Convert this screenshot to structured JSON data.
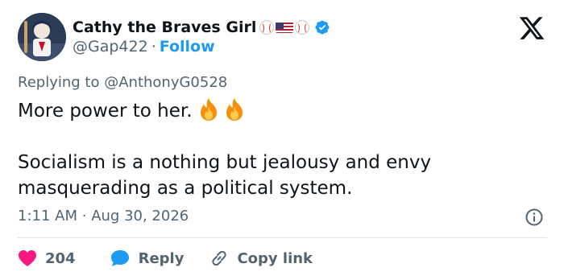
{
  "user": {
    "display_name": "Cathy the Braves Girl",
    "handle": "@Gap422",
    "separator": "·",
    "follow_label": "Follow",
    "badges": [
      "baseball-icon",
      "us-flag-icon",
      "baseball-icon",
      "verified-badge-icon"
    ]
  },
  "tweet": {
    "replying_to_prefix": "Replying to",
    "replying_to_handle": "@AnthonyG0528",
    "line1": "More power to her.",
    "line2": "Socialism is a nothing but jealousy and envy",
    "line3": "masquerading as a political system.",
    "emojis": [
      "fire-icon",
      "fire-icon"
    ],
    "time": "1:11 AM",
    "date": "Aug 30, 2026",
    "meta_separator": "·"
  },
  "actions": {
    "like_count": "204",
    "reply_label": "Reply",
    "copy_link_label": "Copy link"
  },
  "colors": {
    "accent": "#1d9bf0",
    "text": "#0f1419",
    "muted": "#536471",
    "like": "#f91880",
    "divider": "#e1e8ed"
  }
}
